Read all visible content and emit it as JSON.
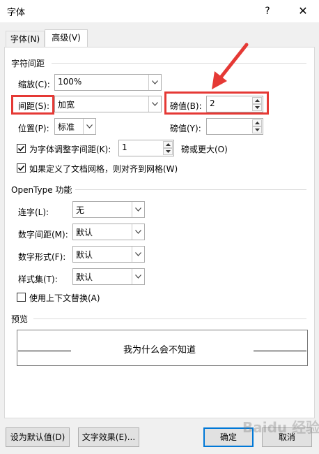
{
  "window": {
    "title": "字体",
    "help": "?",
    "close": "✕"
  },
  "tabs": [
    {
      "label": "字体(N)"
    },
    {
      "label": "高级(V)"
    }
  ],
  "spacing": {
    "title": "字符间距",
    "scale_label": "缩放(C):",
    "scale_value": "100%",
    "spacing_label": "间距(S):",
    "spacing_value": "加宽",
    "spacing_by_label": "磅值(B):",
    "spacing_by_value": "2",
    "position_label": "位置(P):",
    "position_value": "标准",
    "position_by_label": "磅值(Y):",
    "position_by_value": "",
    "kerning_label": "为字体调整字间距(K):",
    "kerning_value": "1",
    "kerning_suffix": "磅或更大(O)",
    "grid_label": "如果定义了文档网格，则对齐到网格(W)"
  },
  "opentype": {
    "title": "OpenType 功能",
    "ligatures_label": "连字(L):",
    "ligatures_value": "无",
    "num_spacing_label": "数字间距(M):",
    "num_spacing_value": "默认",
    "num_forms_label": "数字形式(F):",
    "num_forms_value": "默认",
    "stylistic_label": "样式集(T):",
    "stylistic_value": "默认",
    "contextual_label": "使用上下文替换(A)"
  },
  "preview": {
    "title": "预览",
    "text": "我为什么会不知道"
  },
  "buttons": {
    "set_default": "设为默认值(D)",
    "text_effects": "文字效果(E)...",
    "ok": "确定",
    "cancel": "取消"
  },
  "watermark": "Baidu 经验",
  "colors": {
    "highlight": "#e53935",
    "accent": "#0078d7"
  }
}
